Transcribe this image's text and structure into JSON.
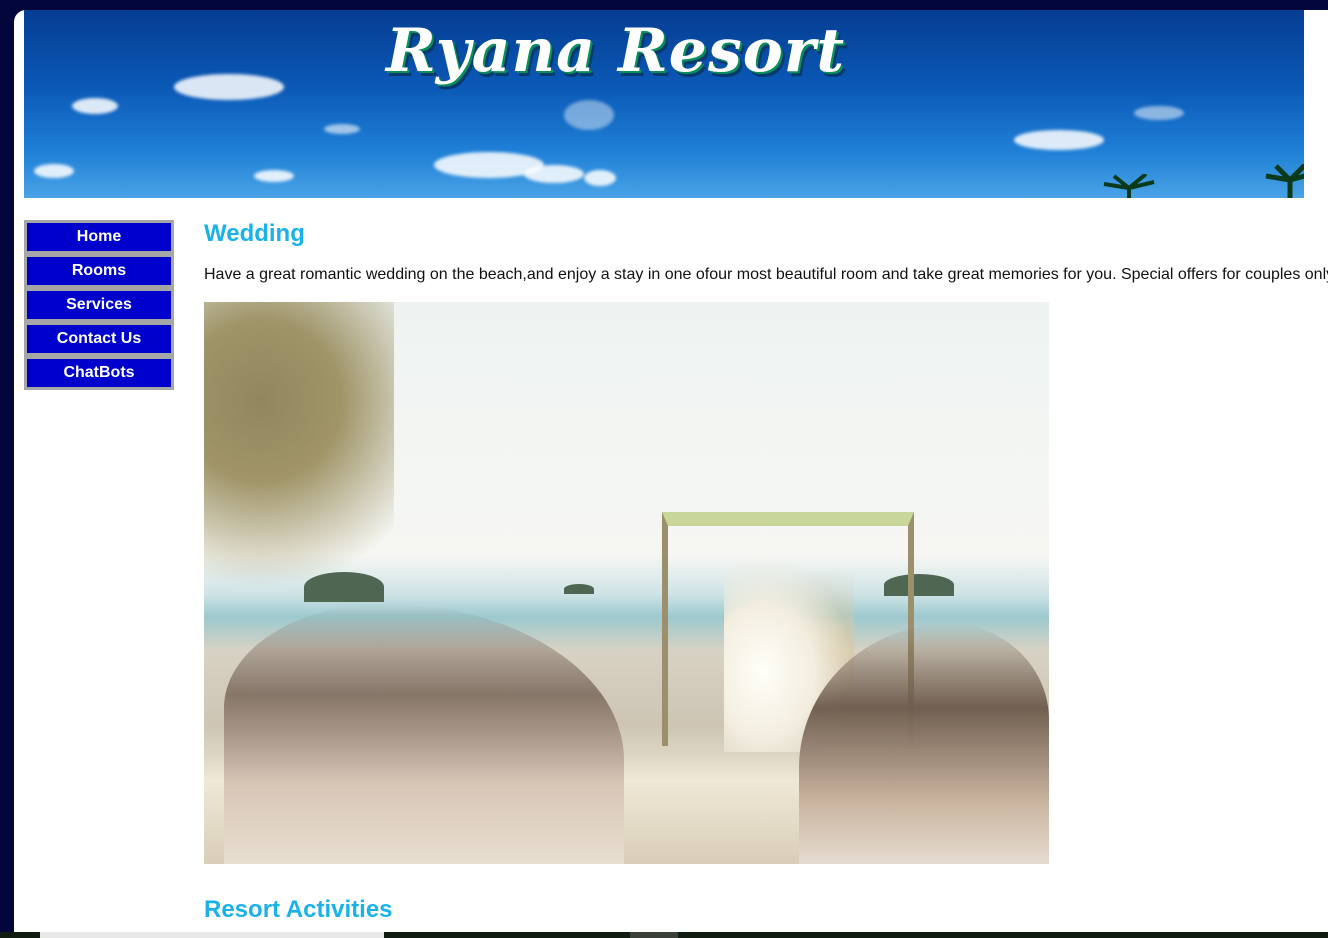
{
  "banner": {
    "title": "Ryana Resort"
  },
  "nav": {
    "items": [
      {
        "label": "Home"
      },
      {
        "label": "Rooms"
      },
      {
        "label": "Services"
      },
      {
        "label": "Contact Us"
      },
      {
        "label": "ChatBots"
      }
    ]
  },
  "main": {
    "title": "Wedding",
    "description": "Have a great romantic wedding on the beach,and enjoy a stay in one ofour most beautiful room and take great memories for you. Special offers for couples only",
    "section_title": "Resort Activities"
  },
  "colors": {
    "nav_bg": "#0000cc",
    "heading": "#1ab2e8",
    "outer_bg": "#02063a"
  }
}
